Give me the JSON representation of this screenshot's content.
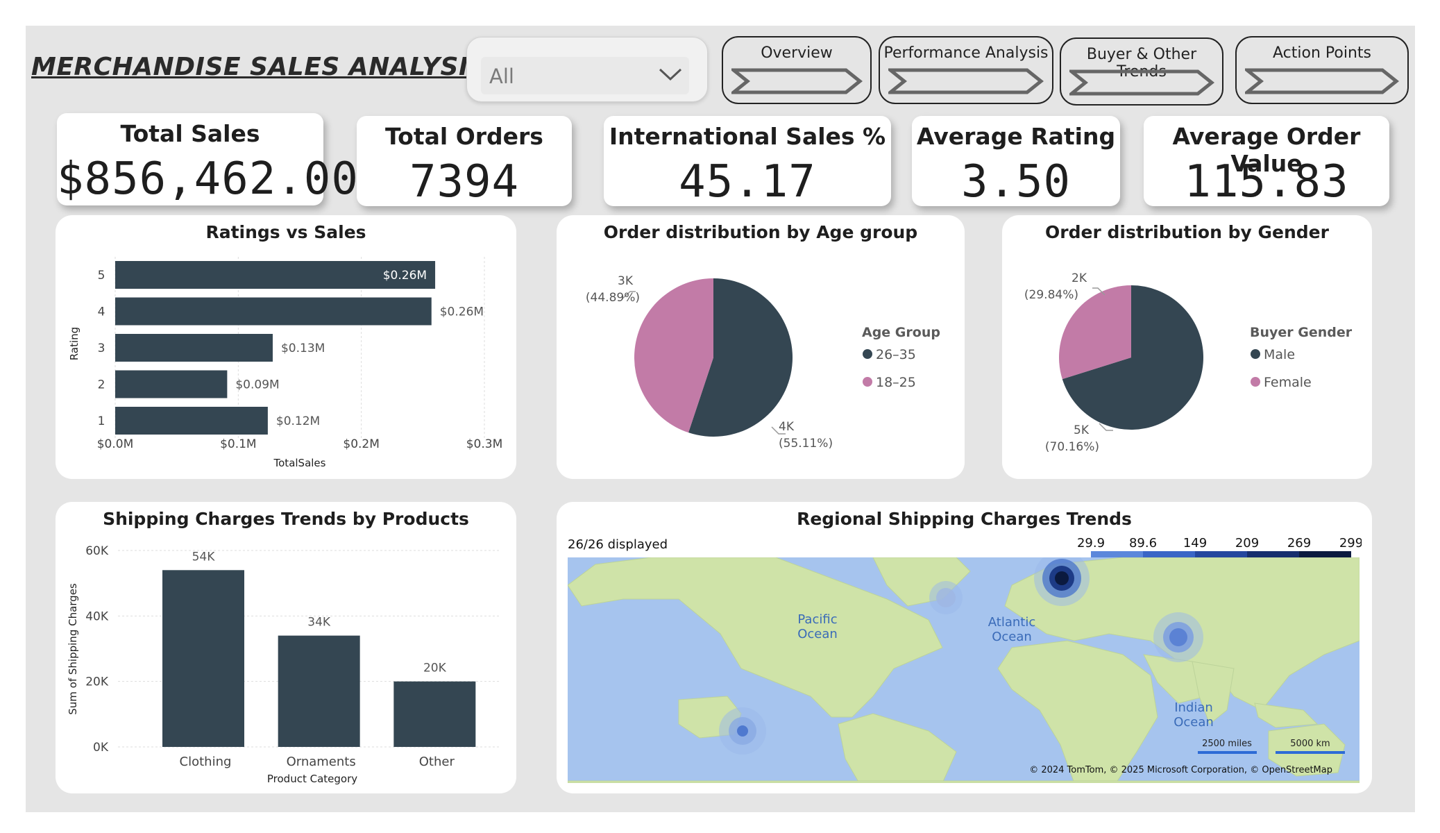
{
  "header": {
    "title": "MERCHANDISE SALES ANALYSIS"
  },
  "slicer": {
    "value": "All",
    "icon": "chevron-down-icon"
  },
  "nav": [
    {
      "label": "Overview"
    },
    {
      "label": "Performance Analysis"
    },
    {
      "label": "Buyer & Other Trends"
    },
    {
      "label": "Action Points"
    }
  ],
  "kpis": [
    {
      "label": "Total Sales",
      "value": "$856,462.00"
    },
    {
      "label": "Total Orders",
      "value": "7394"
    },
    {
      "label": "International Sales %",
      "value": "45.17"
    },
    {
      "label": "Average Rating",
      "value": "3.50"
    },
    {
      "label": "Average Order Value",
      "value": "115.83"
    }
  ],
  "colors": {
    "dark": "#344652",
    "pink": "#c27ba7",
    "bg": "#e5e5e5"
  },
  "chart_data": [
    {
      "type": "bar",
      "orientation": "horizontal",
      "title": "Ratings vs Sales",
      "xlabel": "TotalSales",
      "ylabel": "Rating",
      "categories": [
        "5",
        "4",
        "3",
        "2",
        "1"
      ],
      "values": [
        260000,
        257000,
        128000,
        91000,
        124000
      ],
      "data_labels": [
        "$0.26M",
        "$0.26M",
        "$0.13M",
        "$0.09M",
        "$0.12M"
      ],
      "xticks": [
        "$0.0M",
        "$0.1M",
        "$0.2M",
        "$0.3M"
      ],
      "xlim": [
        0,
        300000
      ]
    },
    {
      "type": "pie",
      "title": "Order distribution by Age group",
      "legend_title": "Age Group",
      "legend_position": "right",
      "slices": [
        {
          "name": "26–35",
          "value": 55.11,
          "label": "4K",
          "pct": "(55.11%)",
          "color": "#344652"
        },
        {
          "name": "18–25",
          "value": 44.89,
          "label": "3K",
          "pct": "(44.89%)",
          "color": "#c27ba7"
        }
      ]
    },
    {
      "type": "pie",
      "title": "Order distribution by Gender",
      "legend_title": "Buyer Gender",
      "legend_position": "right",
      "slices": [
        {
          "name": "Male",
          "value": 70.16,
          "label": "5K",
          "pct": "(70.16%)",
          "color": "#344652"
        },
        {
          "name": "Female",
          "value": 29.84,
          "label": "2K",
          "pct": "(29.84%)",
          "color": "#c27ba7"
        }
      ]
    },
    {
      "type": "bar",
      "title": "Shipping Charges Trends by Products",
      "xlabel": "Product Category",
      "ylabel": "Sum of Shipping Charges",
      "categories": [
        "Clothing",
        "Ornaments",
        "Other"
      ],
      "values": [
        54000,
        34000,
        20000
      ],
      "data_labels": [
        "54K",
        "34K",
        "20K"
      ],
      "yticks": [
        "0K",
        "20K",
        "40K",
        "60K"
      ],
      "ylim": [
        0,
        60000
      ]
    }
  ],
  "map": {
    "title": "Regional Shipping Charges Trends",
    "displayed": "26/26 displayed",
    "legend_values": [
      "29.9",
      "89.6",
      "149",
      "209",
      "269",
      "299"
    ],
    "legend_colors": [
      "#7ea6e8",
      "#5b87db",
      "#3a66c6",
      "#24479e",
      "#162e6e",
      "#0b1a3f"
    ],
    "ocean_labels": [
      {
        "text": "Pacific\nOcean"
      },
      {
        "text": "Atlantic\nOcean"
      },
      {
        "text": "Indian\nOcean"
      }
    ],
    "scale": [
      "2500 miles",
      "5000 km"
    ],
    "copyright": "© 2024 TomTom, © 2025 Microsoft Corporation, © OpenStreetMap"
  }
}
